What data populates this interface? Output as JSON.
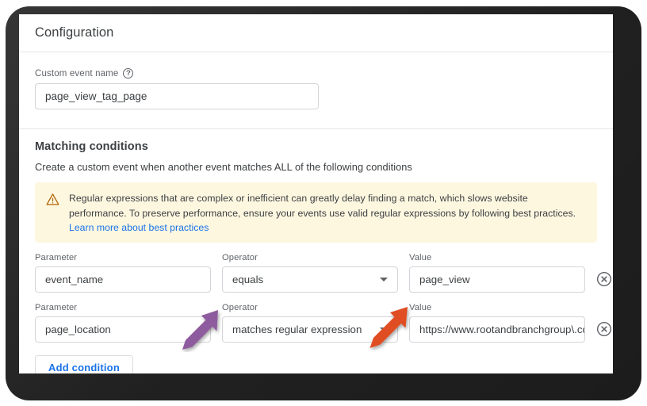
{
  "window": {
    "bezel_color": "#2b2b2b",
    "card_background": "#ffffff"
  },
  "header": {
    "title": "Configuration"
  },
  "custom_event": {
    "label": "Custom event name",
    "help_icon": "help-circle-icon",
    "value": "page_view_tag_page",
    "placeholder": "Custom event name"
  },
  "matching": {
    "title": "Matching conditions",
    "description": "Create a custom event when another event matches ALL of the following conditions"
  },
  "warning": {
    "icon": "warning-triangle-icon",
    "background": "#fef7e0",
    "text": "Regular expressions that are complex or inefficient can greatly delay finding a match, which slows website performance. To preserve performance, ensure your events use valid regular expressions by following best practices.",
    "link_text": "Learn more about best practices",
    "link_color": "#1a73e8"
  },
  "conditions": {
    "labels": {
      "parameter": "Parameter",
      "operator": "Operator",
      "value": "Value"
    },
    "rows": [
      {
        "parameter": "event_name",
        "operator": "equals",
        "value": "page_view",
        "remove_icon": "remove-circle-x-icon"
      },
      {
        "parameter": "page_location",
        "operator": "matches regular expression",
        "value": "https://www.rootandbranchgroup\\.co",
        "remove_icon": "remove-circle-x-icon"
      }
    ]
  },
  "actions": {
    "add_condition_label": "Add condition",
    "add_condition_color": "#1a73e8"
  },
  "annotations": [
    {
      "name": "purple-arrow",
      "color": "#8e5b9e",
      "points_to": "operator-dropdown-row-2",
      "direction": "up-right"
    },
    {
      "name": "orange-arrow",
      "color": "#e04d23",
      "points_to": "value-field-row-2",
      "direction": "up-right"
    }
  ]
}
